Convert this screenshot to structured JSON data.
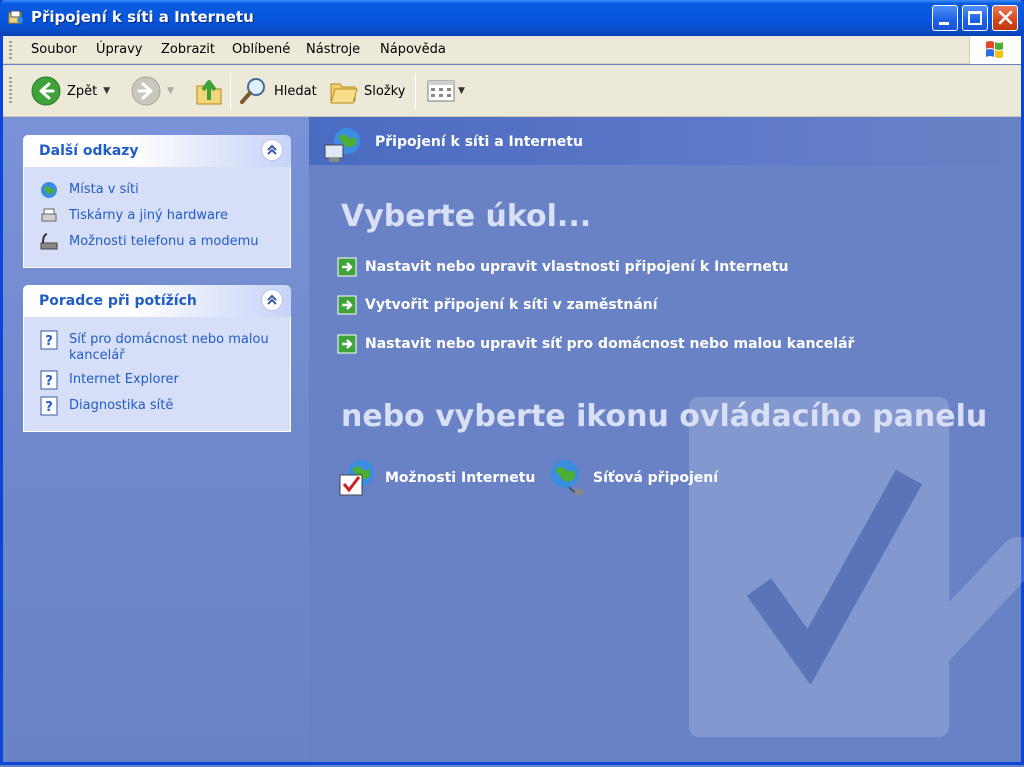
{
  "window": {
    "title": "Připojení k síti a Internetu"
  },
  "menu": [
    "Soubor",
    "Úpravy",
    "Zobrazit",
    "Oblíbené",
    "Nástroje",
    "Nápověda"
  ],
  "toolbar": {
    "back": "Zpět",
    "search": "Hledat",
    "folders": "Složky"
  },
  "sidebar": {
    "panels": [
      {
        "title": "Další odkazy",
        "items": [
          {
            "label": "Místa v síti",
            "icon": "network-places-icon"
          },
          {
            "label": "Tiskárny a jiný hardware",
            "icon": "printers-icon"
          },
          {
            "label": "Možnosti telefonu a modemu",
            "icon": "phone-modem-icon"
          }
        ]
      },
      {
        "title": "Poradce při potížích",
        "items": [
          {
            "label": "Síť pro domácnost nebo malou kancelář",
            "icon": "help-icon"
          },
          {
            "label": "Internet Explorer",
            "icon": "help-icon"
          },
          {
            "label": "Diagnostika sítě",
            "icon": "help-icon"
          }
        ]
      }
    ]
  },
  "main": {
    "header": "Připojení k síti a Internetu",
    "pick_task": "Vyberte úkol...",
    "tasks": [
      "Nastavit nebo upravit vlastnosti připojení k Internetu",
      "Vytvořit připojení k síti v zaměstnání",
      "Nastavit nebo upravit síť pro domácnost nebo malou kancelář"
    ],
    "pick_icon": "nebo vyberte ikonu ovládacího panelu",
    "icons": [
      {
        "label": "Možnosti Internetu",
        "icon": "internet-options-icon"
      },
      {
        "label": "Síťová připojení",
        "icon": "network-connections-icon"
      }
    ]
  },
  "colors": {
    "titlebar": "#0855dd",
    "pane_bg": "#6982c6",
    "link": "#215dc6",
    "task_arrow": "#3fa33a"
  }
}
